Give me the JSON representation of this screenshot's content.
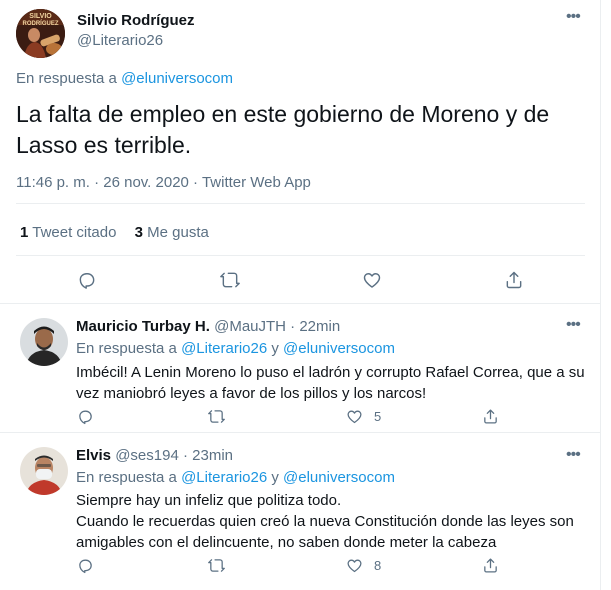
{
  "main_tweet": {
    "author_name": "Silvio Rodríguez",
    "author_handle": "@Literario26",
    "reply_prefix": "En respuesta a ",
    "reply_to": "@eluniversocom",
    "text": "La falta de empleo en este gobierno de Moreno y de Lasso es terrible.",
    "meta": "11:46 p. m. · 26 nov. 2020 · Twitter Web App",
    "stats": {
      "quote_count": "1",
      "quote_label": "Tweet citado",
      "like_count": "3",
      "like_label": "Me gusta"
    },
    "avatar_text": "SILVIO RODRÍGUEZ"
  },
  "replies": [
    {
      "author_name": "Mauricio Turbay H.",
      "author_handle": "@MauJTH",
      "time": "22min",
      "reply_prefix": "En respuesta a ",
      "reply_to_1": "@Literario26",
      "reply_and": " y ",
      "reply_to_2": "@eluniversocom",
      "lines": [
        "Imbécil! A Lenin Moreno lo puso el ladrón y corrupto Rafael Correa, que a su",
        "vez maniobró leyes a favor de los pillos y los narcos!"
      ],
      "like_count": "5"
    },
    {
      "author_name": "Elvis",
      "author_handle": "@ses194",
      "time": "23min",
      "reply_prefix": "En respuesta a ",
      "reply_to_1": "@Literario26",
      "reply_and": " y ",
      "reply_to_2": "@eluniversocom",
      "lines": [
        "Siempre hay un infeliz que politiza todo.",
        "Cuando le recuerdas quien creó la nueva Constitución donde las leyes son",
        "amigables con el delincuente, no saben donde meter la cabeza"
      ],
      "like_count": "8"
    }
  ],
  "separator": " · ",
  "more_icon_glyph": "•••",
  "colors": {
    "link": "#1b95e0",
    "secondary_text": "#5b7083",
    "primary_text": "#0f1419",
    "border": "#ebeef0"
  },
  "icons": [
    "reply-icon",
    "retweet-icon",
    "like-icon",
    "share-icon",
    "more-icon"
  ]
}
